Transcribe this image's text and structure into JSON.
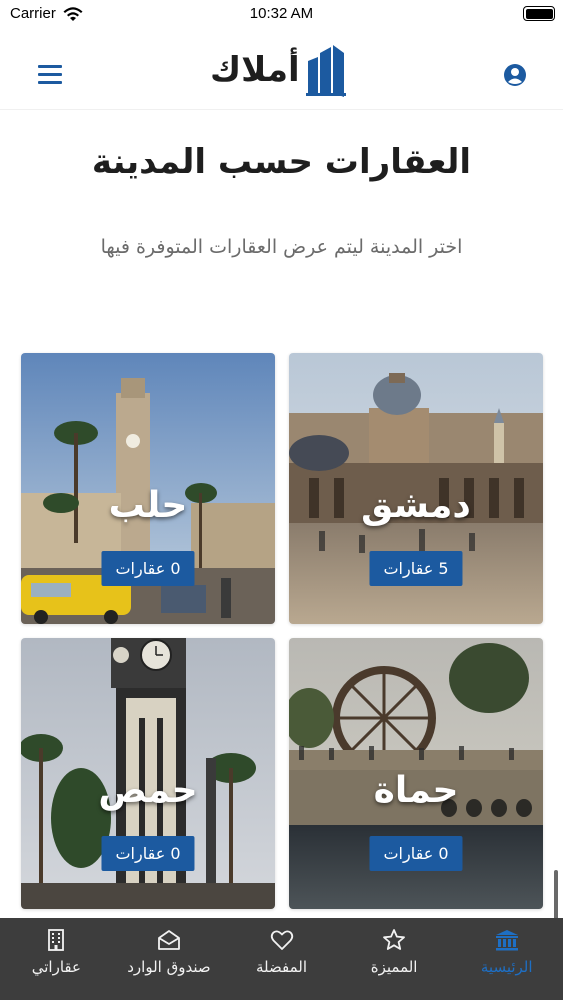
{
  "status_bar": {
    "carrier": "Carrier",
    "time": "10:32 AM"
  },
  "header": {
    "logo_text": "أملاك"
  },
  "page": {
    "title": "العقارات حسب المدينة",
    "subtitle": "اختر المدينة ليتم عرض العقارات المتوفرة فيها"
  },
  "cities": [
    {
      "name": "دمشق",
      "count_label": "5 عقارات"
    },
    {
      "name": "حلب",
      "count_label": "0 عقارات"
    },
    {
      "name": "حماة",
      "count_label": "0 عقارات"
    },
    {
      "name": "حمص",
      "count_label": "0 عقارات"
    }
  ],
  "tabs": [
    {
      "label": "الرئيسية",
      "icon": "bank-icon",
      "active": true
    },
    {
      "label": "المميزة",
      "icon": "star-icon"
    },
    {
      "label": "المفضلة",
      "icon": "heart-icon"
    },
    {
      "label": "صندوق الوارد",
      "icon": "inbox-icon"
    },
    {
      "label": "عقاراتي",
      "icon": "building-icon"
    }
  ],
  "colors": {
    "accent": "#1c5aa0",
    "active_tab": "#1e6fc4",
    "tab_bar_bg": "#3d3d3d"
  }
}
